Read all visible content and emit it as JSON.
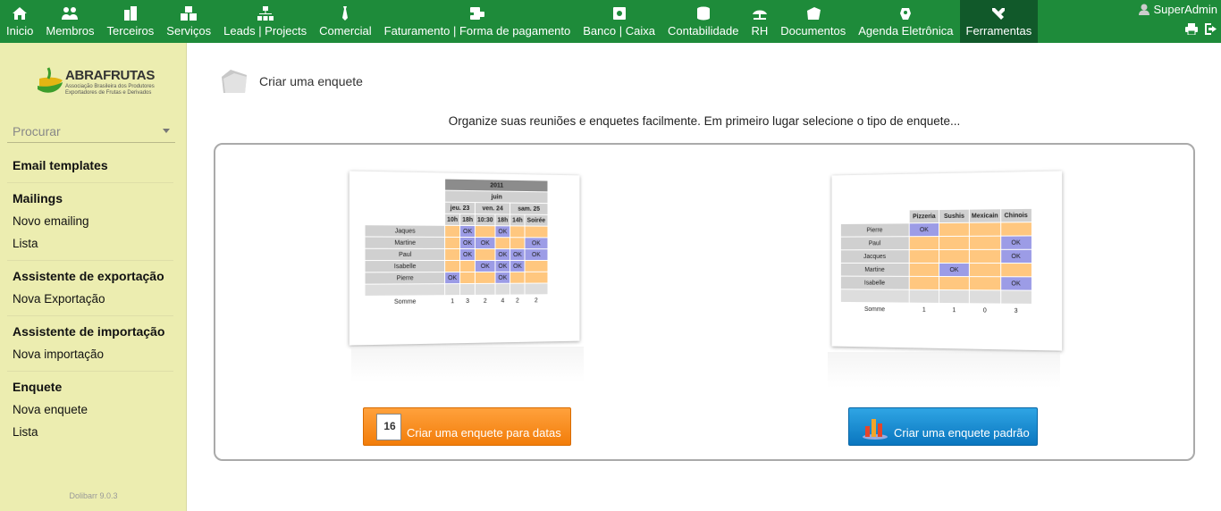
{
  "nav": [
    {
      "label": "Inicio",
      "icon": "home-icon"
    },
    {
      "label": "Membros",
      "icon": "members-icon"
    },
    {
      "label": "Terceiros",
      "icon": "building-icon"
    },
    {
      "label": "Serviços",
      "icon": "boxes-icon"
    },
    {
      "label": "Leads | Projects",
      "icon": "sitemap-icon"
    },
    {
      "label": "Comercial",
      "icon": "tie-icon"
    },
    {
      "label": "Faturamento | Forma de pagamento",
      "icon": "money-icon"
    },
    {
      "label": "Banco | Caixa",
      "icon": "safe-icon"
    },
    {
      "label": "Contabilidade",
      "icon": "coins-icon"
    },
    {
      "label": "RH",
      "icon": "umbrella-icon"
    },
    {
      "label": "Documentos",
      "icon": "folder-icon"
    },
    {
      "label": "Agenda Eletrônica",
      "icon": "agenda-icon"
    },
    {
      "label": "Ferramentas",
      "icon": "tools-icon",
      "active": true
    }
  ],
  "user": {
    "name": "SuperAdmin"
  },
  "logo": {
    "name": "ABRAFRUTAS",
    "subtitle": "Associação Brasileira dos Produtores Exportadores de Frutas e Derivados"
  },
  "sidebar": {
    "search_label": "Procurar",
    "email_templates": "Email templates",
    "mailings": "Mailings",
    "novo_emailing": "Novo emailing",
    "lista1": "Lista",
    "export": "Assistente de exportação",
    "nova_exportacao": "Nova Exportação",
    "import": "Assistente de importação",
    "nova_importacao": "Nova importação",
    "enquete": "Enquete",
    "nova_enquete": "Nova enquete",
    "lista2": "Lista",
    "version": "Dolibarr 9.0.3"
  },
  "main": {
    "title": "Criar uma enquete",
    "intro": "Organize suas reuniões e enquetes facilmente. Em primeiro lugar selecione o tipo de enquete...",
    "btn_dates": "Criar uma enquete para datas",
    "btn_standard": "Criar uma enquete padrão",
    "cal_day": "16"
  },
  "preview_dates": {
    "year": "2011",
    "month": "juin",
    "days": [
      "jeu. 23",
      "ven. 24",
      "sam. 25"
    ],
    "hours": [
      "10h",
      "18h",
      "10:30",
      "18h",
      "14h",
      "Soirée"
    ],
    "rows": [
      {
        "name": "Jaques",
        "cells": [
          "o",
          "k",
          "o",
          "k",
          "o",
          "o"
        ]
      },
      {
        "name": "Martine",
        "cells": [
          "o",
          "k",
          "k",
          "o",
          "o",
          "k"
        ]
      },
      {
        "name": "Paul",
        "cells": [
          "o",
          "k",
          "o",
          "k",
          "k",
          "k"
        ]
      },
      {
        "name": "Isabelle",
        "cells": [
          "o",
          "o",
          "k",
          "k",
          "k",
          "o"
        ]
      },
      {
        "name": "Pierre",
        "cells": [
          "k",
          "o",
          "o",
          "k",
          "o",
          "o"
        ]
      }
    ],
    "ok": "OK",
    "sum_label": "Somme",
    "sums": [
      "1",
      "3",
      "2",
      "4",
      "2",
      "2"
    ]
  },
  "preview_standard": {
    "options": [
      "Pizzeria",
      "Sushis",
      "Mexicain",
      "Chinois"
    ],
    "rows": [
      {
        "name": "Pierre",
        "cells": [
          "k",
          "o",
          "o",
          "o"
        ]
      },
      {
        "name": "Paul",
        "cells": [
          "o",
          "o",
          "o",
          "k"
        ]
      },
      {
        "name": "Jacques",
        "cells": [
          "o",
          "o",
          "o",
          "k"
        ]
      },
      {
        "name": "Martine",
        "cells": [
          "o",
          "k",
          "o",
          "o"
        ]
      },
      {
        "name": "Isabelle",
        "cells": [
          "o",
          "o",
          "o",
          "k"
        ]
      }
    ],
    "ok": "OK",
    "sum_label": "Somme",
    "sums": [
      "1",
      "1",
      "0",
      "3"
    ]
  }
}
